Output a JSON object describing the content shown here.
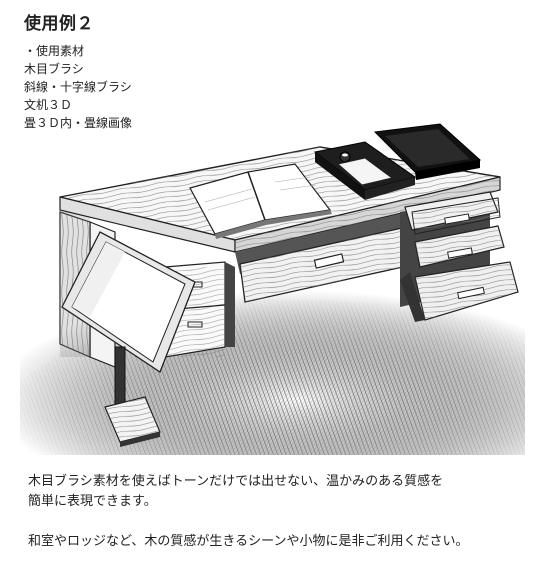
{
  "title": "使用例２",
  "materials": {
    "header": "・使用素材",
    "items": [
      "木目ブラシ",
      "斜線・十字線ブラシ",
      "文机３Ｄ",
      "畳３Ｄ内・畳線画像"
    ]
  },
  "description": {
    "line1": "木目ブラシ素材を使えばトーンだけでは出せない、温かみのある質感を",
    "line2": "簡単に表現できます。",
    "line3": "和室やロッジなど、木の質感が生きるシーンや小物に是非ご利用ください。"
  }
}
